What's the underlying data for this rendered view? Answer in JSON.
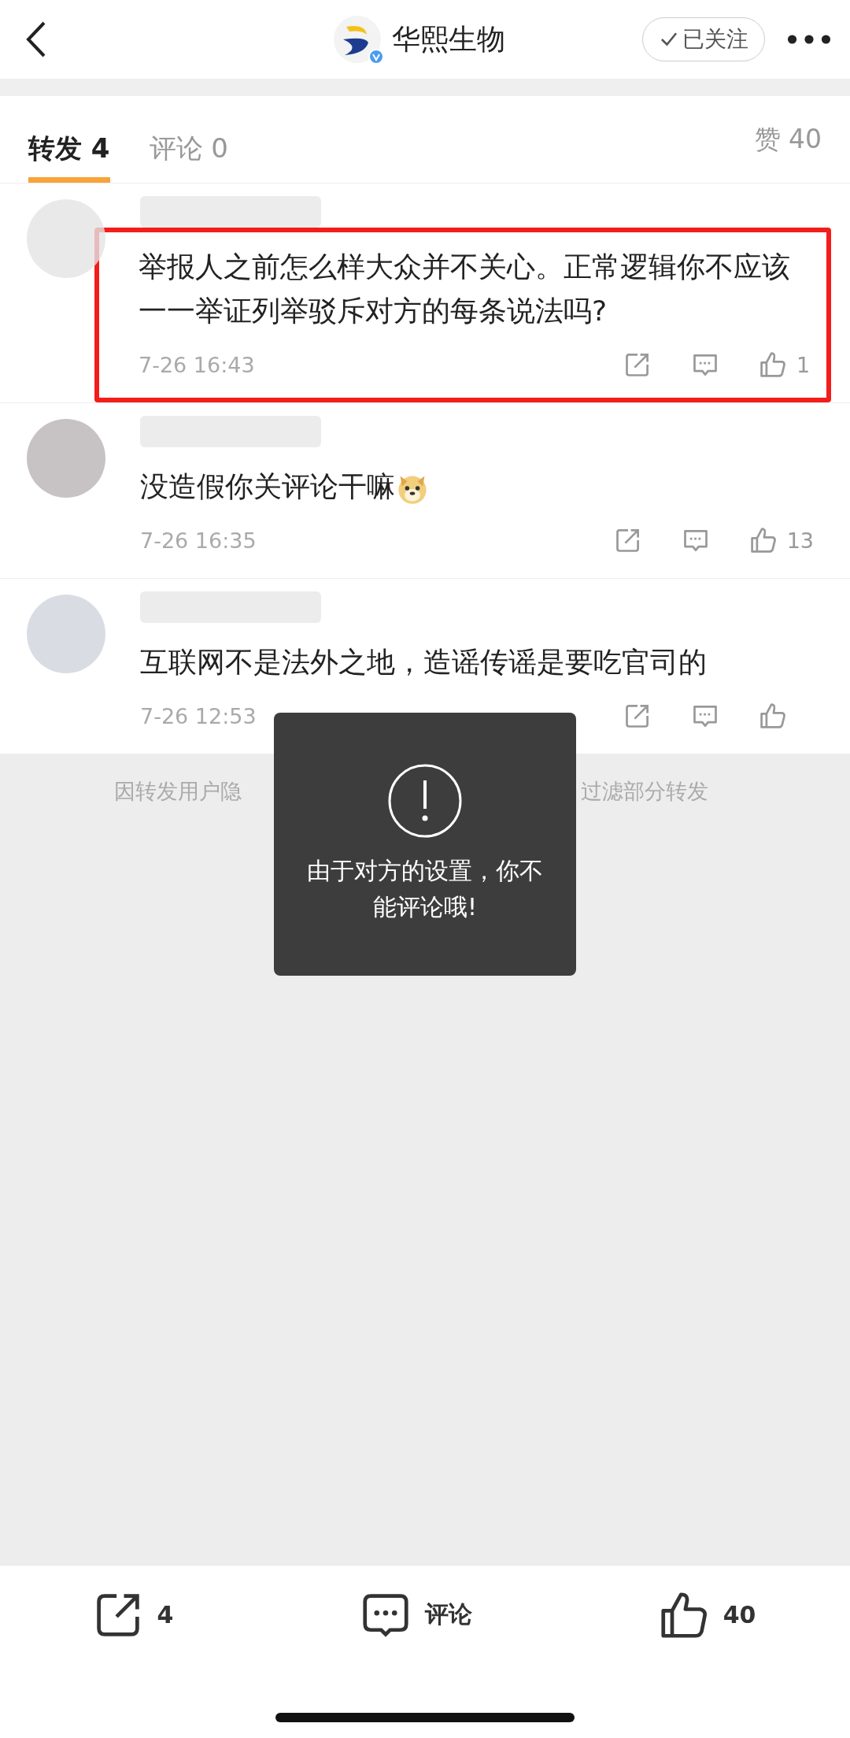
{
  "header": {
    "title": "华熙生物",
    "verified": true,
    "follow": {
      "label": "已关注",
      "following": true
    }
  },
  "tabs": [
    {
      "label": "转发 4",
      "selected": true
    },
    {
      "label": "评论 0",
      "selected": false
    }
  ],
  "likes_total": "赞 40",
  "comments": [
    {
      "text": "举报人之前怎么样大众并不关心。正常逻辑你不应该一一举证列举驳斥对方的每条说法吗?",
      "time": "7-26 16:43",
      "likes": "1",
      "highlighted": true,
      "emoji": false
    },
    {
      "text": "没造假你关评论干嘛",
      "time": "7-26 16:35",
      "likes": "13",
      "highlighted": false,
      "emoji": true
    },
    {
      "text": "互联网不是法外之地，造谣传谣是要吃官司的",
      "time": "7-26 12:53",
      "highlighted": false,
      "emoji": false
    }
  ],
  "filter_note": {
    "left": "因转发用户隐",
    "right": "过滤部分转发"
  },
  "toast": {
    "message": "由于对方的设置，你不能评论哦!"
  },
  "action_bar": {
    "repost": "4",
    "comment": "评论",
    "like": "40"
  }
}
